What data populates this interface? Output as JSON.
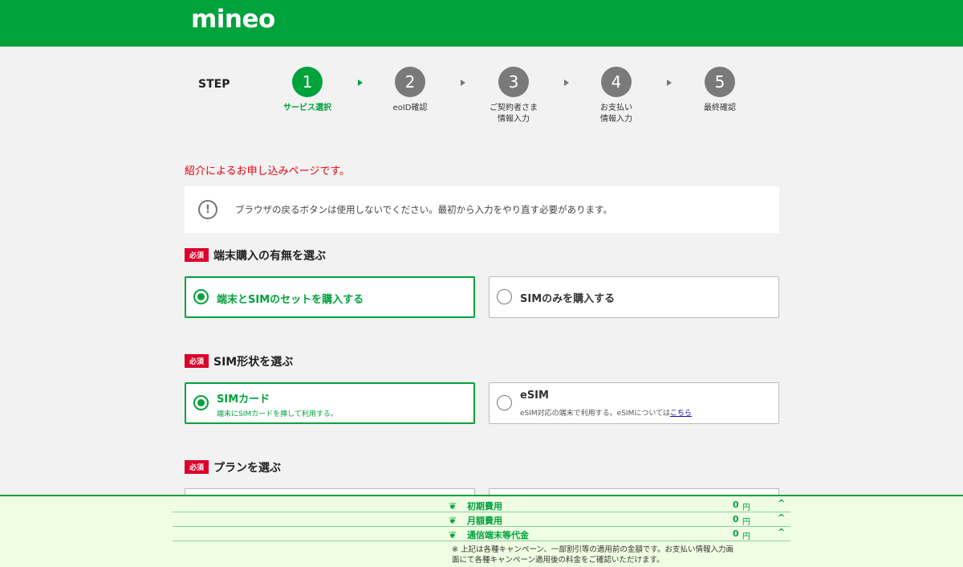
{
  "brand": {
    "logo": "mineo"
  },
  "steps": {
    "heading": "STEP",
    "items": [
      {
        "num": "1",
        "label": "サービス選択"
      },
      {
        "num": "2",
        "label": "eoID確認"
      },
      {
        "num": "3",
        "label": "ご契約者さま\n情報入力"
      },
      {
        "num": "4",
        "label": "お支払い\n情報入力"
      },
      {
        "num": "5",
        "label": "最終確認"
      }
    ]
  },
  "intro": "紹介によるお申し込みページです。",
  "notice": {
    "icon": "!",
    "text": "ブラウザの戻るボタンは使用しないでください。最初から入力をやり直す必要があります。"
  },
  "required_badge": "必須",
  "sections": {
    "device": {
      "title": "端末購入の有無を選ぶ",
      "options": [
        "端末とSIMのセットを購入する",
        "SIMのみを購入する"
      ]
    },
    "sim": {
      "title": "SIM形状を選ぶ",
      "options": [
        {
          "title": "SIMカード",
          "sub": "端末にSIMカードを挿して利用する。"
        },
        {
          "title": "eSIM",
          "sub": "eSIM対応の端末で利用する。eSIMについては",
          "link": "こちら"
        }
      ]
    },
    "plan": {
      "title": "プランを選ぶ"
    }
  },
  "fees": {
    "unit": "円",
    "rows": [
      {
        "name": "初期費用",
        "value": "0"
      },
      {
        "name": "月額費用",
        "value": "0"
      },
      {
        "name": "通信端末等代金",
        "value": "0"
      }
    ],
    "note": "※ 上記は各種キャンペーン、一部割引等の適用前の金額です。お支払い情報入力画面にて各種キャンペーン適用後の料金をご確認いただけます。"
  }
}
